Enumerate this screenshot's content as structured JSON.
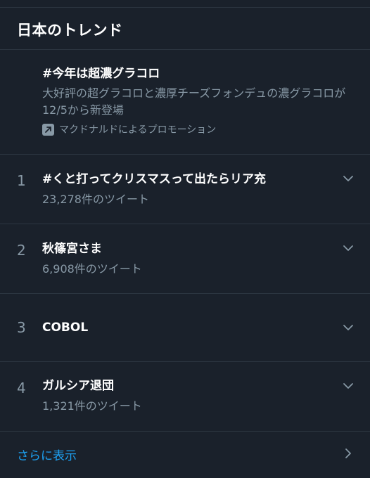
{
  "header": {
    "title": "日本のトレンド"
  },
  "promoted": {
    "title": "#今年は超濃グラコロ",
    "description": "大好評の超グラコロと濃厚チーズフォンデュの濃グラコロが12/5から新登場",
    "promoted_by": "マクドナルドによるプロモーション",
    "icon": "promoted-arrow-icon"
  },
  "trends": [
    {
      "rank": "1",
      "name": "#くと打ってクリスマスって出たらリア充",
      "count": "23,278件のツイート"
    },
    {
      "rank": "2",
      "name": "秋篠宮さま",
      "count": "6,908件のツイート"
    },
    {
      "rank": "3",
      "name": "COBOL",
      "count": ""
    },
    {
      "rank": "4",
      "name": "ガルシア退団",
      "count": "1,321件のツイート"
    }
  ],
  "footer": {
    "show_more": "さらに表示"
  },
  "colors": {
    "background": "#1a212b",
    "divider": "#2c3641",
    "secondary_text": "#8899a6",
    "accent": "#1da1f2"
  }
}
